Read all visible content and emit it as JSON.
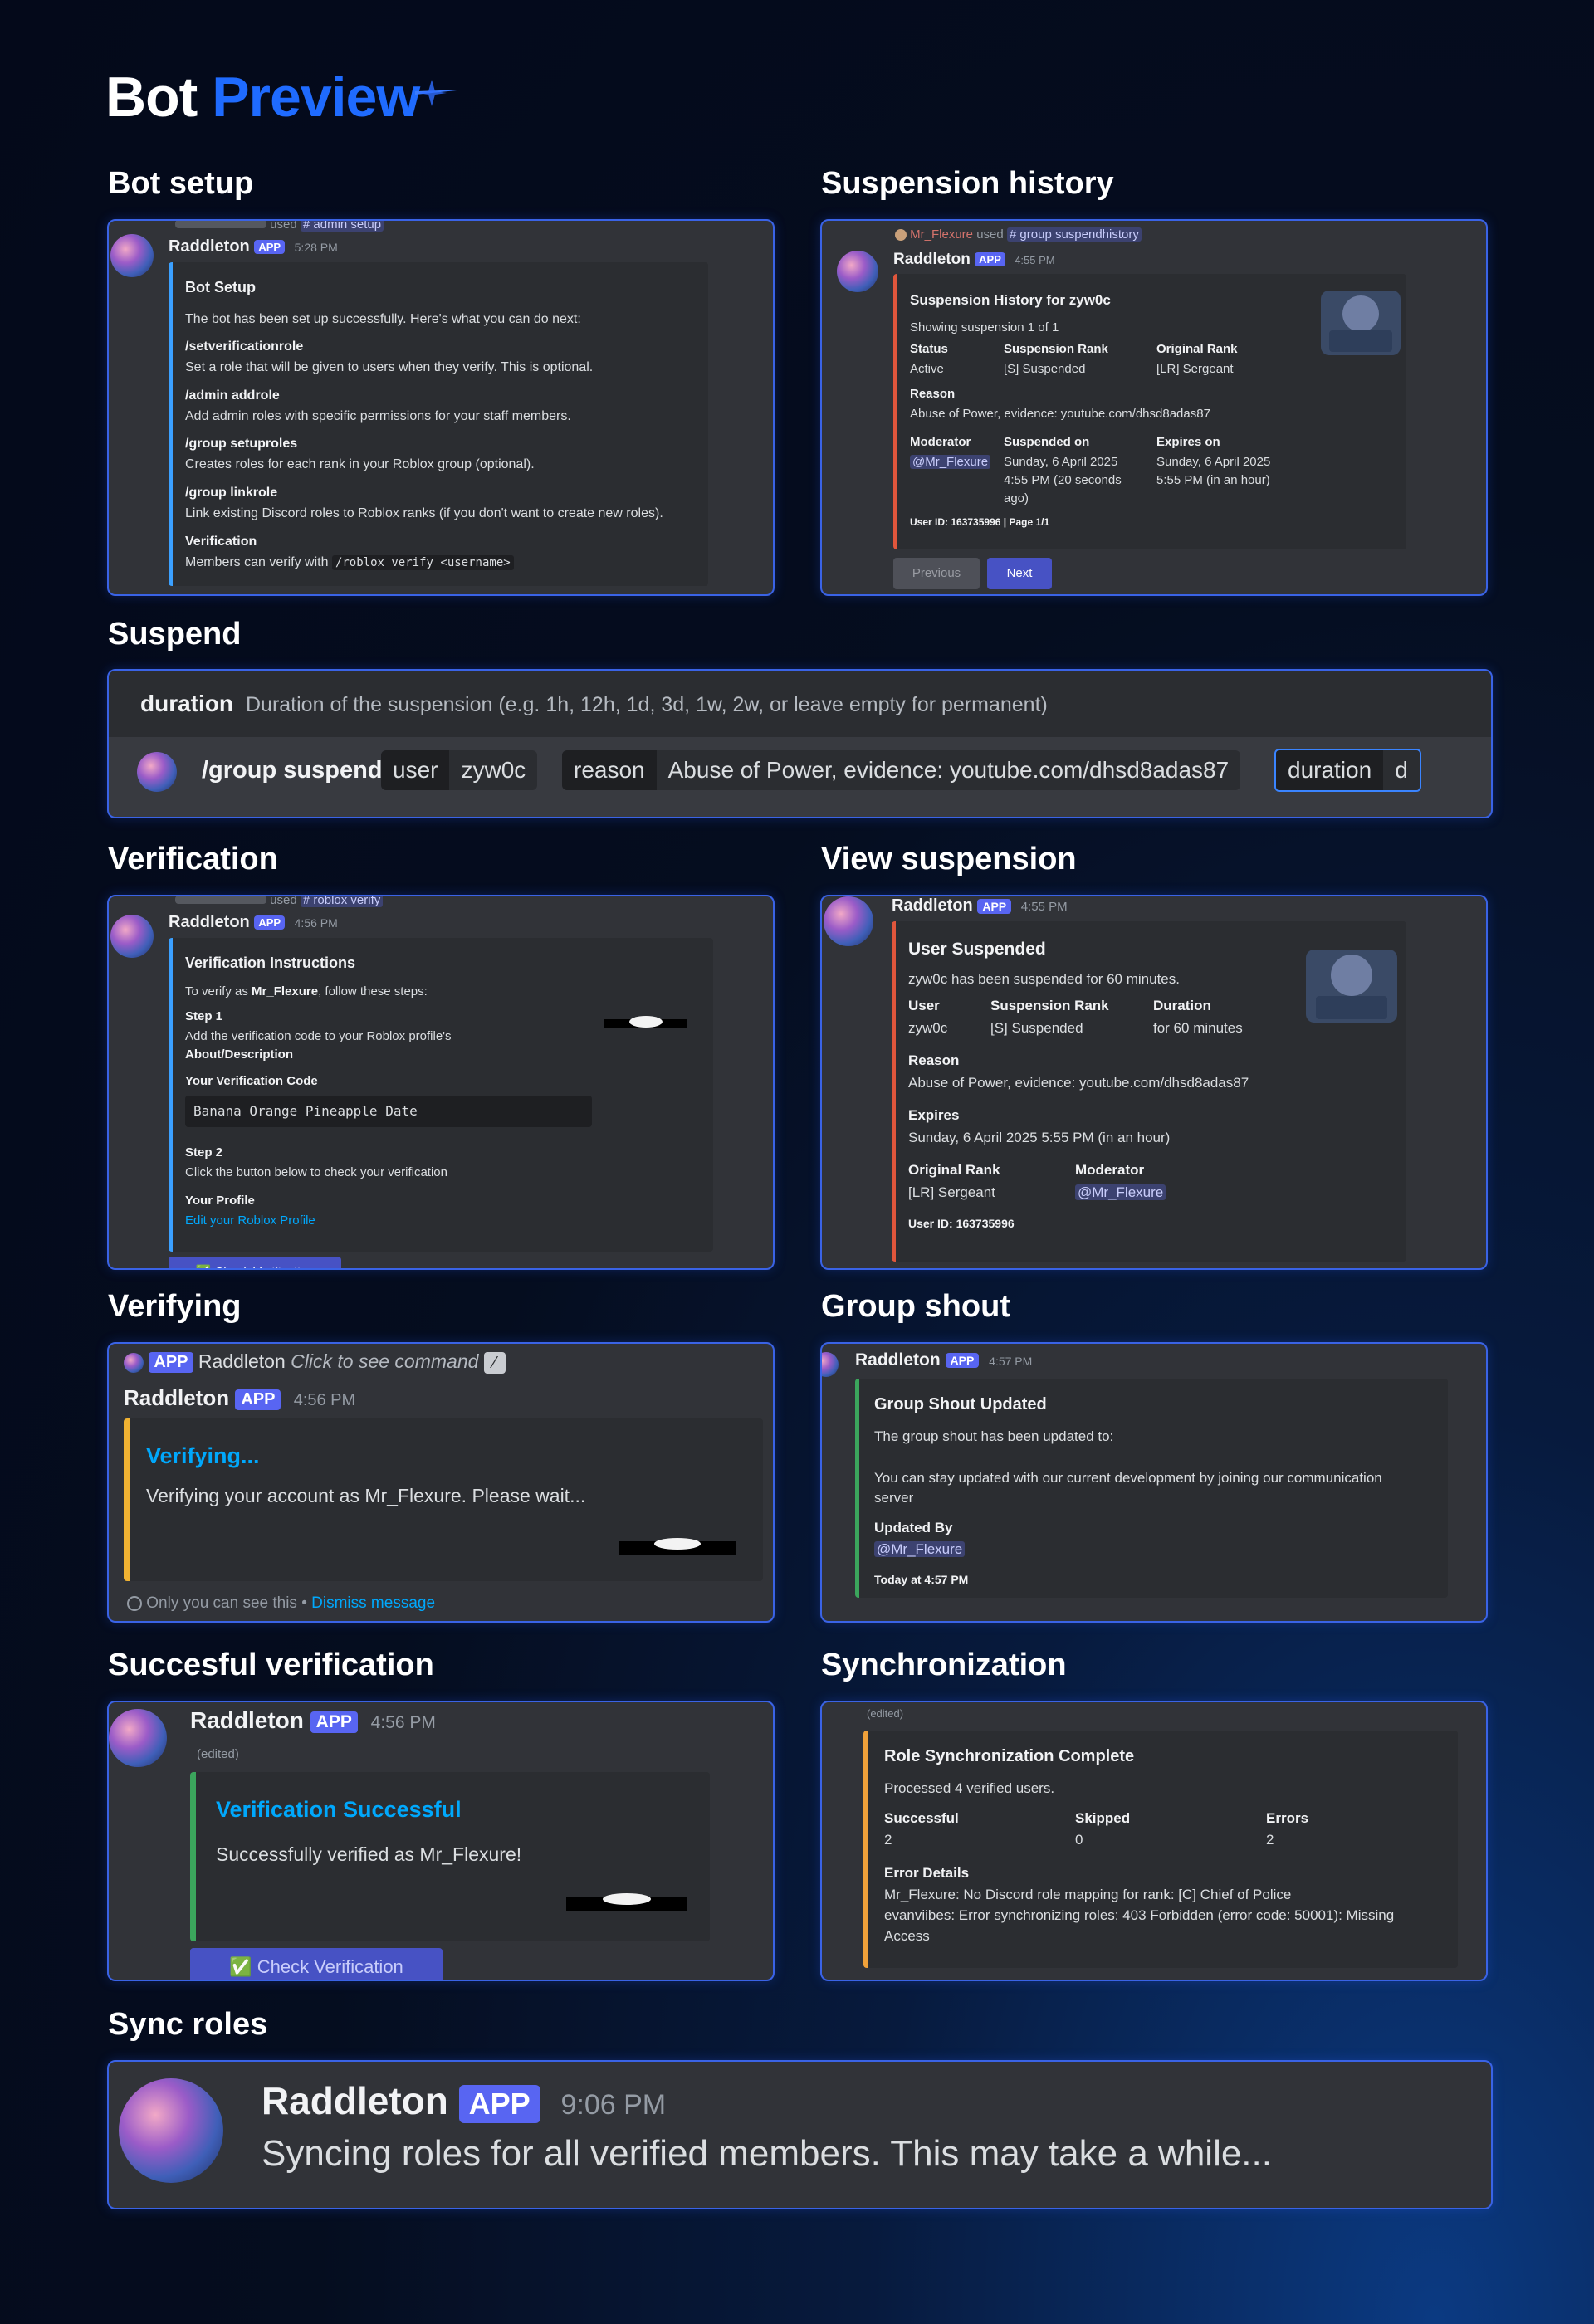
{
  "page": {
    "title_part1": "Bot",
    "title_part2": "Preview"
  },
  "sections": {
    "bot_setup": "Bot setup",
    "suspension_history": "Suspension history",
    "suspend": "Suspend",
    "verification": "Verification",
    "view_suspension": "View suspension",
    "verifying": "Verifying",
    "group_shout": "Group shout",
    "succesful_verification": "Succesful verification",
    "synchronization": "Synchronization",
    "sync_roles": "Sync roles"
  },
  "bot": {
    "name": "Raddleton",
    "badge": "APP"
  },
  "bot_setup": {
    "reply_used": "used",
    "reply_command": "# admin setup",
    "time": "5:28 PM",
    "embed_title": "Bot Setup",
    "intro": "The bot has been set up successfully. Here's what you can do next:",
    "items": [
      {
        "cmd": "/setverificationrole",
        "desc": "Set a role that will be given to users when they verify. This is optional."
      },
      {
        "cmd": "/admin addrole",
        "desc": "Add admin roles with specific permissions for your staff members."
      },
      {
        "cmd": "/group setuproles",
        "desc": "Creates roles for each rank in your Roblox group (optional)."
      },
      {
        "cmd": "/group linkrole",
        "desc": "Link existing Discord roles to Roblox ranks (if you don't want to create new roles)."
      }
    ],
    "verification_title": "Verification",
    "verification_text": "Members can verify with",
    "verification_code": "/roblox verify <username>"
  },
  "suspension_history": {
    "reply_user": "Mr_Flexure",
    "reply_used": "used",
    "reply_command": "# group suspendhistory",
    "time": "4:55 PM",
    "embed_title": "Suspension History for zyw0c",
    "showing": "Showing suspension 1 of 1",
    "status_label": "Status",
    "status_value": "Active",
    "rank_label": "Suspension Rank",
    "rank_value": "[S] Suspended",
    "orig_label": "Original Rank",
    "orig_value": "[LR] Sergeant",
    "reason_label": "Reason",
    "reason_value": "Abuse of Power, evidence: youtube.com/dhsd8adas87",
    "mod_label": "Moderator",
    "mod_value": "@Mr_Flexure",
    "suspended_label": "Suspended on",
    "suspended_l1": "Sunday, 6 April 2025",
    "suspended_l2": "4:55 PM (20 seconds",
    "suspended_l3": "ago)",
    "expires_label": "Expires on",
    "expires_l1": "Sunday, 6 April 2025",
    "expires_l2": "5:55 PM (in an hour)",
    "footer": "User ID: 163735996 | Page 1/1",
    "prev_button": "Previous",
    "next_button": "Next"
  },
  "suspend": {
    "option_name": "duration",
    "option_desc": "Duration of the suspension (e.g. 1h, 12h, 1d, 3d, 1w, 2w, or leave empty for permanent)",
    "command": "/group suspend",
    "user_label": "user",
    "user_value": "zyw0c",
    "reason_label": "reason",
    "reason_value": "Abuse of Power, evidence: youtube.com/dhsd8adas87",
    "duration_label": "duration",
    "duration_value": "d"
  },
  "verification": {
    "reply_used": "used",
    "reply_command": "# roblox verify",
    "time": "4:56 PM",
    "embed_title": "Verification Instructions",
    "intro_pre": "To verify as ",
    "intro_user": "Mr_Flexure",
    "intro_post": ", follow these steps:",
    "step1_title": "Step 1",
    "step1_text": "Add the verification code to your Roblox profile's",
    "step1_bold": "About/Description",
    "code_title": "Your Verification Code",
    "code_value": "Banana Orange Pineapple Date",
    "step2_title": "Step 2",
    "step2_text": "Click the button below to check your verification",
    "profile_title": "Your Profile",
    "profile_link": "Edit your Roblox Profile",
    "button": "✅ Check Verification"
  },
  "view_suspension": {
    "time": "4:55 PM",
    "embed_title": "User Suspended",
    "desc": "zyw0c has been suspended for 60 minutes.",
    "user_label": "User",
    "user_value": "zyw0c",
    "rank_label": "Suspension Rank",
    "rank_value": "[S] Suspended",
    "duration_label": "Duration",
    "duration_value": "for 60 minutes",
    "reason_label": "Reason",
    "reason_value": "Abuse of Power, evidence: youtube.com/dhsd8adas87",
    "expires_label": "Expires",
    "expires_value": "Sunday, 6 April 2025 5:55 PM (in an hour)",
    "orig_label": "Original Rank",
    "orig_value": "[LR] Sergeant",
    "mod_label": "Moderator",
    "mod_value": "@Mr_Flexure",
    "footer": "User ID: 163735996"
  },
  "verifying": {
    "reply_text": "Click to see command",
    "time": "4:56 PM",
    "embed_title": "Verifying...",
    "desc": "Verifying your account as Mr_Flexure. Please wait...",
    "ephemeral": "Only you can see this •",
    "dismiss": "Dismiss message"
  },
  "group_shout": {
    "time": "4:57 PM",
    "embed_title": "Group Shout Updated",
    "line1": "The group shout has been updated to:",
    "line2": "You can stay updated with our current development by joining our communication",
    "line3": "server",
    "updated_by_label": "Updated By",
    "updated_by_value": "@Mr_Flexure",
    "footer": "Today at 4:57 PM"
  },
  "succesful_verification": {
    "time": "4:56 PM",
    "edited": "(edited)",
    "embed_title": "Verification Successful",
    "desc": "Successfully verified as Mr_Flexure!",
    "button": "✅ Check Verification"
  },
  "synchronization": {
    "edited": "(edited)",
    "embed_title": "Role Synchronization Complete",
    "desc": "Processed 4 verified users.",
    "successful_label": "Successful",
    "successful_value": "2",
    "skipped_label": "Skipped",
    "skipped_value": "0",
    "errors_label": "Errors",
    "errors_value": "2",
    "details_label": "Error Details",
    "detail1": "Mr_Flexure: No Discord role mapping for rank: [C] Chief of Police",
    "detail2": "evanviibes: Error synchronizing roles: 403 Forbidden (error code: 50001): Missing",
    "detail3": "Access"
  },
  "sync_roles": {
    "time": "9:06 PM",
    "message": "Syncing roles for all verified members. This may take a while..."
  },
  "colors": {
    "accent": "#1f6bff",
    "panel_border": "#3a63e6",
    "blurple": "#5865f2",
    "green": "#3ba55c",
    "red": "#da373c",
    "orange": "#f0a13a",
    "yellow": "#f0b232"
  }
}
